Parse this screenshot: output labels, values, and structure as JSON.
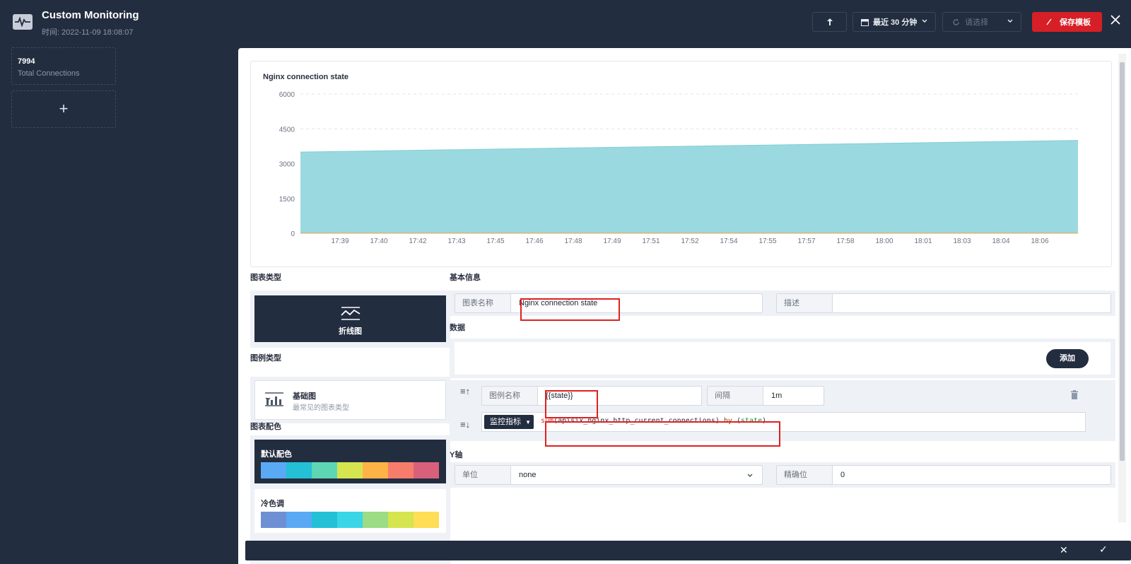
{
  "app": {
    "title": "Custom Monitoring",
    "time": "时间: 2022-11-09 18:08:07"
  },
  "toolbar": {
    "time_range": "最近 30 分钟",
    "refresh_placeholder": "请选择",
    "save_label": "保存模板"
  },
  "sidebar": {
    "cards": [
      {
        "value": "7994",
        "label": "Total Connections"
      }
    ],
    "add_symbol": "+"
  },
  "chart": {
    "title": "Nginx connection state"
  },
  "chart_data": {
    "type": "area",
    "title": "Nginx connection state",
    "x_ticks": [
      "17:39",
      "17:40",
      "17:42",
      "17:43",
      "17:45",
      "17:46",
      "17:48",
      "17:49",
      "17:51",
      "17:52",
      "17:54",
      "17:55",
      "17:57",
      "17:58",
      "18:00",
      "18:01",
      "18:03",
      "18:04",
      "18:06"
    ],
    "y_ticks": [
      0,
      1500,
      3000,
      4500,
      6000
    ],
    "ylim": [
      0,
      6000
    ],
    "grid": "horizontal dashed",
    "series": [
      {
        "x_start": "17:38",
        "x_end": "18:08",
        "values": [
          3500,
          4000
        ],
        "color": "#9bd9e0"
      }
    ]
  },
  "editor": {
    "chart_type_label": "图表类型",
    "chart_type_selected": "折线图",
    "legend_type_label": "图例类型",
    "legend_type_title": "基础图",
    "legend_type_sub": "最常见的图表类型",
    "palette_label": "图表配色",
    "palettes": [
      {
        "name": "默认配色",
        "colors": [
          "#5aa9f5",
          "#23c0d6",
          "#5ed6b4",
          "#d6e450",
          "#ffb347",
          "#f87c6b",
          "#d9607a"
        ]
      },
      {
        "name": "冷色调",
        "colors": [
          "#6e8fd4",
          "#5aa9f5",
          "#23c0d6",
          "#3ad6e8",
          "#9bdc84",
          "#d6e450",
          "#ffdd55"
        ]
      }
    ],
    "basic_info_label": "基本信息",
    "chart_name_label": "图表名称",
    "chart_name_value": "Nginx connection state",
    "desc_label": "描述",
    "desc_value": "",
    "data_label": "数据",
    "add_label": "添加",
    "legend_name_label": "图例名称",
    "legend_name_value": "{{state}}",
    "interval_label": "间隔",
    "interval_value": "1m",
    "metric_label": "监控指标",
    "query": {
      "fn": "sum",
      "arg": "apisix_nginx_http_current_connections",
      "kw": "by",
      "label": "state"
    },
    "y_axis_label": "Y轴",
    "unit_label": "单位",
    "unit_value": "none",
    "precision_label": "精确位",
    "precision_value": "0"
  }
}
